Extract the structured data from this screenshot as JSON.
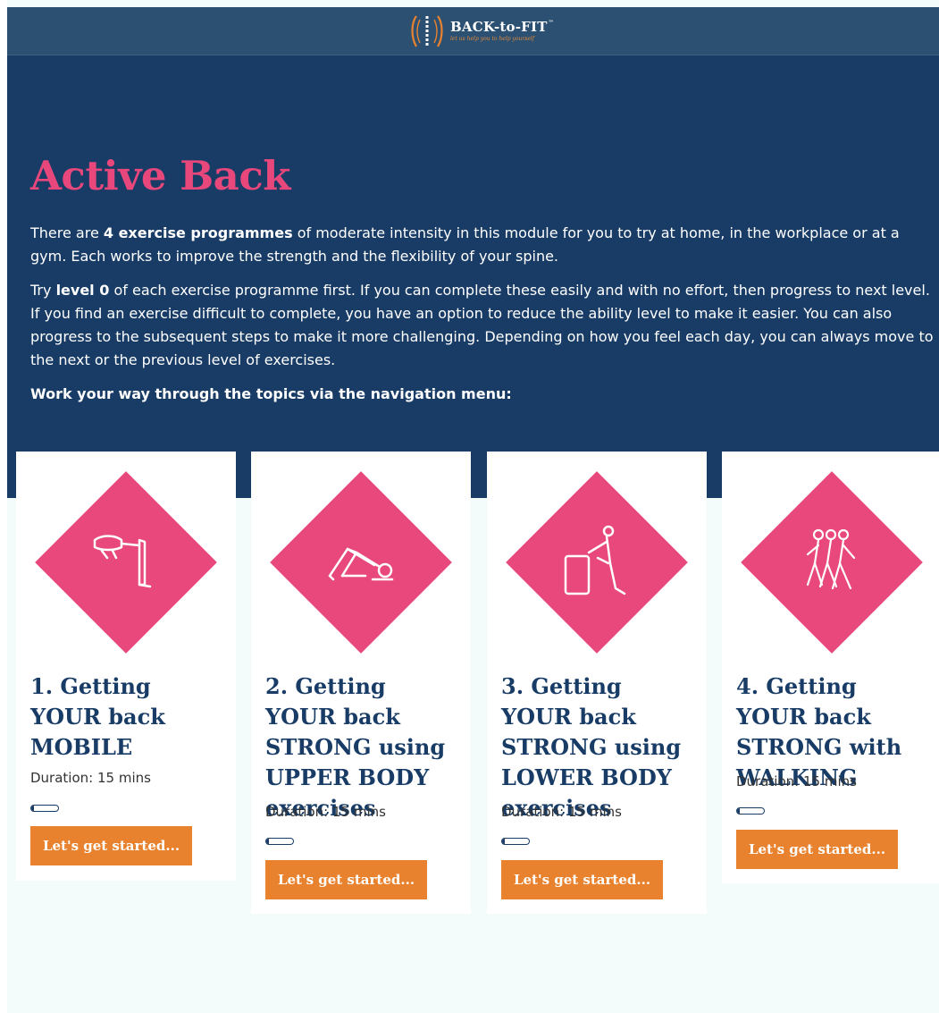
{
  "header": {
    "logo_name": "BACK-to-FIT",
    "logo_tm": "™",
    "logo_tagline": "let us help you to help yourself"
  },
  "hero": {
    "title": "Active Back",
    "p1_before": "There are ",
    "p1_bold": "4 exercise programmes",
    "p1_after": " of moderate intensity in this module for you to try at home, in the workplace or at a gym. Each works to improve the strength and the flexibility of your spine.",
    "p2_before": "Try ",
    "p2_bold": "level 0",
    "p2_after": " of each exercise programme first. If you can complete these easily and with no effort, then progress to next level. If you find an exercise difficult to complete, you have an option to reduce the ability level to make it easier. You can also progress to the subsequent steps to make it more challenging. Depending on how you feel each day, you can always move to the next or the previous level of exercises.",
    "nav_prompt": "Work your way through the topics via the navigation menu:"
  },
  "cards": [
    {
      "title": "1. Getting YOUR back MOBILE",
      "duration": "Duration: 15 mins",
      "progress": 0.1,
      "button": "Let's get started...",
      "icon": "stretching-figure-icon"
    },
    {
      "title": "2. Getting YOUR back STRONG using UPPER BODY exercises",
      "duration": "Duration: 15 mins",
      "progress": 0.1,
      "button": "Let's get started...",
      "icon": "plank-figure-icon"
    },
    {
      "title": "3. Getting YOUR back STRONG using LOWER BODY exercises",
      "duration": "Duration: 15 mins",
      "progress": 0.1,
      "button": "Let's get started...",
      "icon": "step-up-figure-icon"
    },
    {
      "title": "4. Getting YOUR back STRONG with WALKING",
      "duration": "Duration: 15 mins",
      "progress": 0.1,
      "button": "Let's get started...",
      "icon": "walking-group-icon"
    }
  ],
  "colors": {
    "navy": "#183c66",
    "header": "#2c5072",
    "pink": "#e8477c",
    "orange": "#e8822e"
  }
}
